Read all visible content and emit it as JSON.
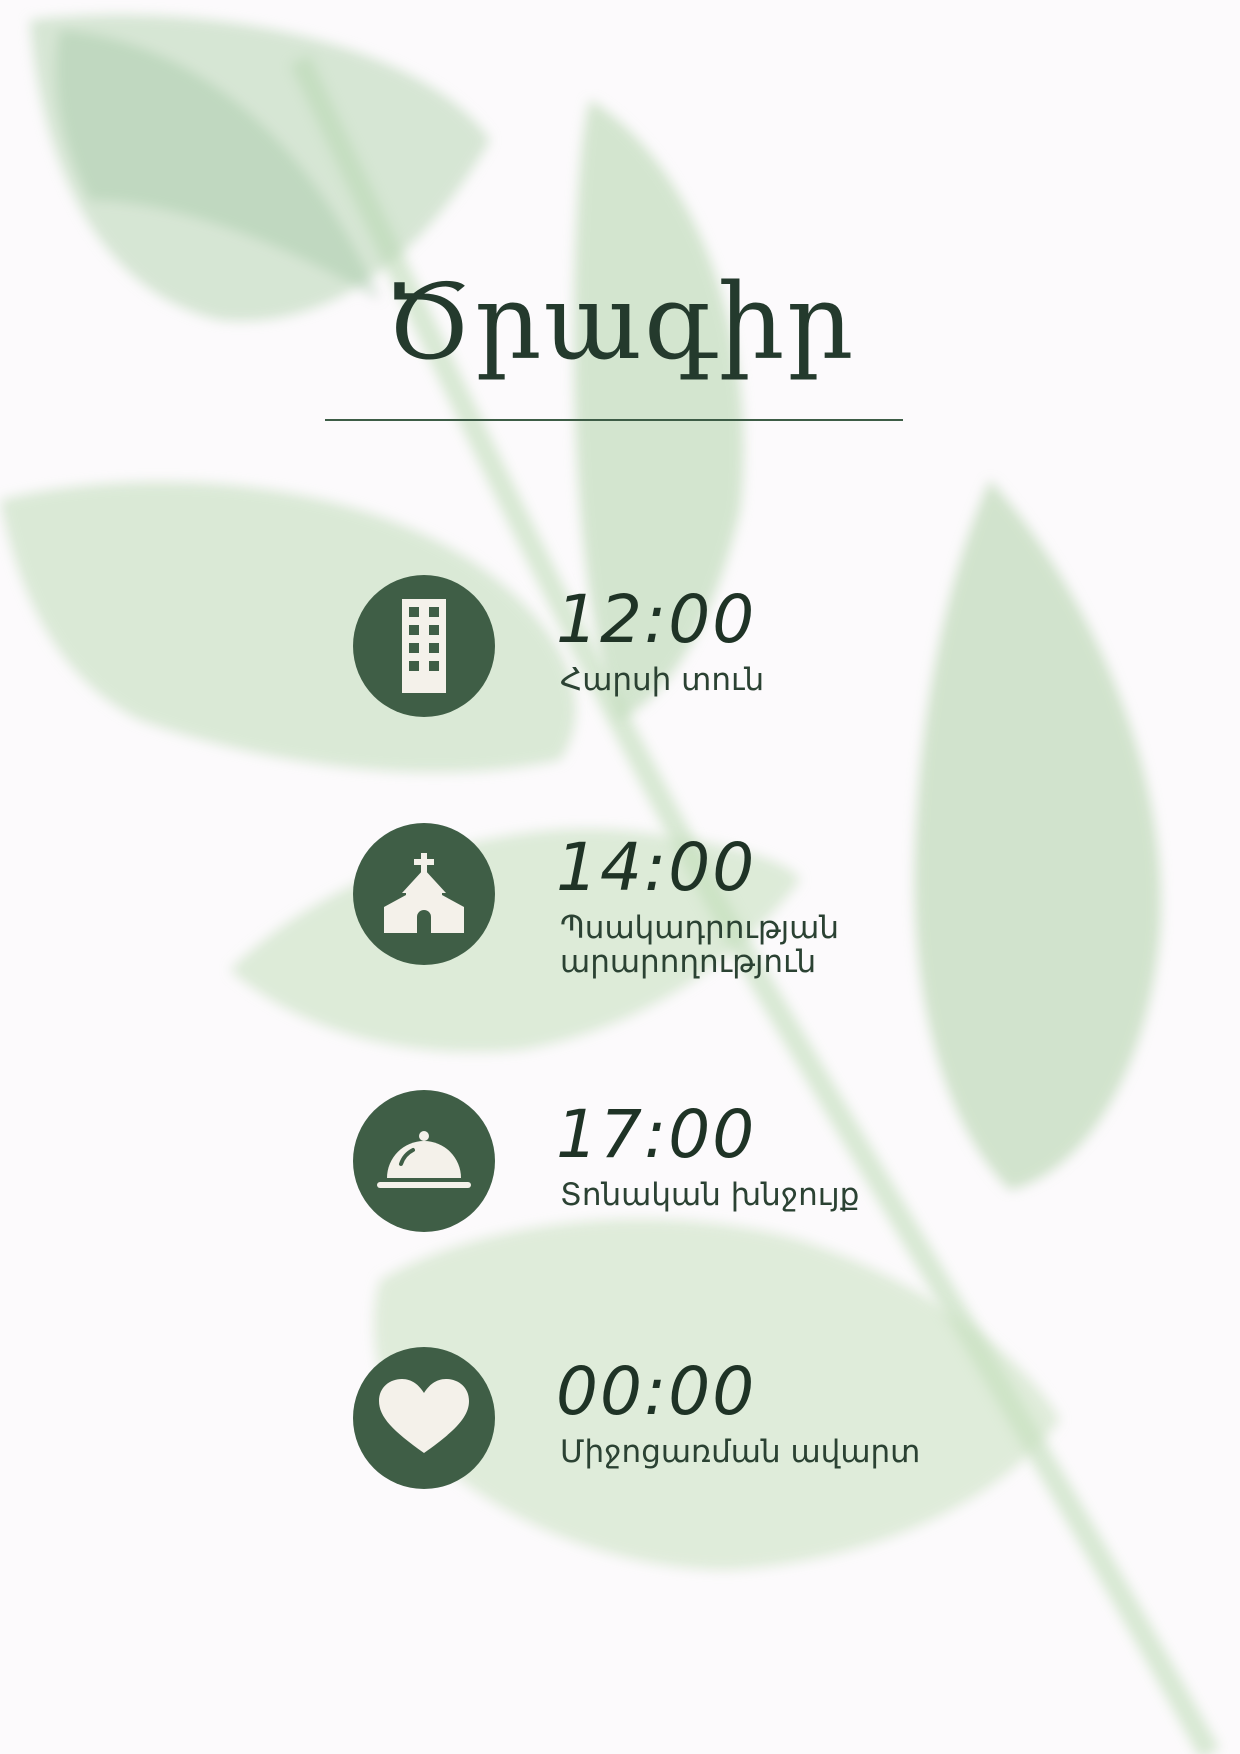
{
  "title": "Ծրագիր",
  "events": [
    {
      "time": "12:00",
      "label": "Հարսի տուն",
      "icon": "building-icon"
    },
    {
      "time": "14:00",
      "label": "Պսակադրության արարողություն",
      "icon": "church-icon"
    },
    {
      "time": "17:00",
      "label": "Տոնական խնջույք",
      "icon": "cloche-icon"
    },
    {
      "time": "00:00",
      "label": "Միջոցառման ավարտ",
      "icon": "heart-icon"
    }
  ],
  "colors": {
    "accent": "#3f5e46",
    "text": "#1f3326",
    "background": "#fcfafc",
    "leaf": "#a8cfa0"
  }
}
